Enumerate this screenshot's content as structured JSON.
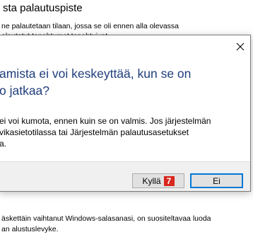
{
  "background_window": {
    "title": "sta palautuspiste",
    "description_line1": "ne palautetaan tilaan, jossa se oli ennen alla olevassa",
    "description_line2": "alautetut tapahtumat tapahtuivat",
    "bottom_line1": "äskettäin vaihtanut Windows-salasanasi, on suositeltavaa luoda",
    "bottom_line2": "an alustuslevyke."
  },
  "dialog": {
    "question_line1": "amista ei voi keskeyttää, kun se on",
    "question_line2": "o jatkaa?",
    "body_line1": "ei voi kumota, ennen kuin se on valmis. Jos järjestelmän",
    "body_line2": "vikasietotilassa tai Järjestelmän palautusasetukset",
    "body_line3": "a.",
    "close_glyph": "✕",
    "yes_label": "Kyllä",
    "yes_badge": "7",
    "no_label": "Ei"
  },
  "colors": {
    "question_text": "#1f3d7a",
    "badge": "#d9261c",
    "focus_border": "#0078d7"
  }
}
